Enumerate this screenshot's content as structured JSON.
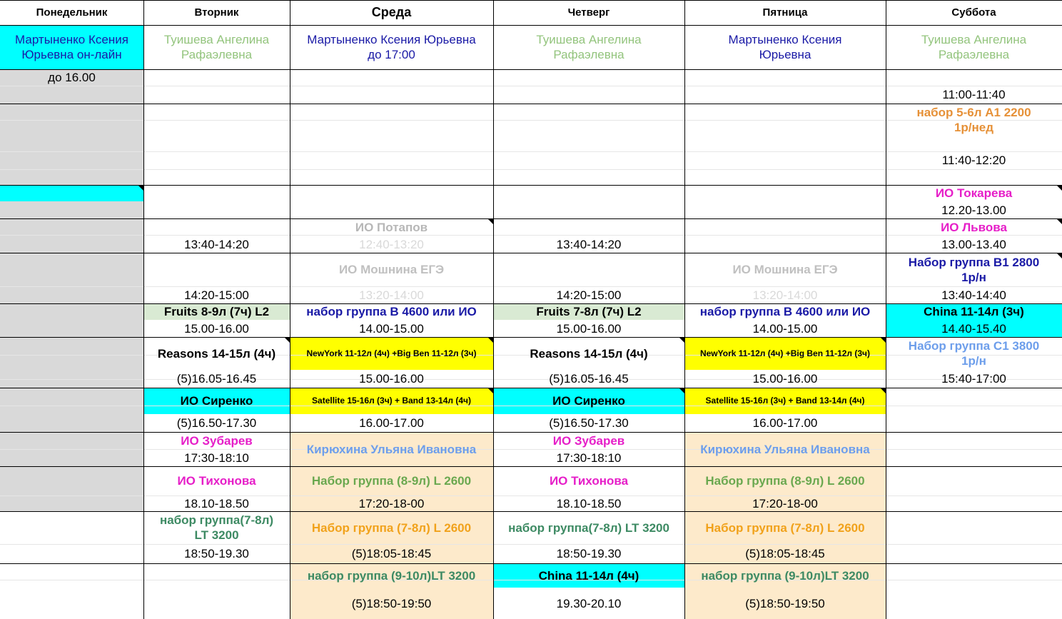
{
  "headers": [
    "Понедельник",
    "Вторник",
    "Среда",
    "Четверг",
    "Пятница",
    "Суббота"
  ],
  "cells": [
    {
      "name": "teacher-monday",
      "text": "Мартыненко Ксения\nЮрьевна он-лайн",
      "color": "#1a1aa6",
      "bold": false
    },
    {
      "name": "teacher-tuesday",
      "text": "Туишева Ангелина\nРафаэлевна",
      "color": "#93c47d",
      "bold": false
    },
    {
      "name": "teacher-wednesday",
      "text": "Мартыненко Ксения Юрьевна\nдо 17:00",
      "color": "#1a1aa6",
      "bold": false
    },
    {
      "name": "teacher-thursday",
      "text": "Туишева Ангелина\nРафаэлевна",
      "color": "#93c47d",
      "bold": false
    },
    {
      "name": "teacher-friday",
      "text": "Мартыненко Ксения\nЮрьевна",
      "color": "#1a1aa6",
      "bold": false
    },
    {
      "name": "teacher-saturday",
      "text": "Туишева Ангелина\nРафаэлевна",
      "color": "#93c47d",
      "bold": false
    },
    {
      "name": "monday-until",
      "text": "до 16.00",
      "color": "#000000",
      "bold": false
    },
    {
      "name": "sat-time-1100",
      "text": "11:00-11:40",
      "color": "#000000",
      "bold": false
    },
    {
      "name": "sat-nabor-a1",
      "text": "набор 5-6л A1 2200\n1р/нед",
      "color": "#e69138",
      "bold": true
    },
    {
      "name": "sat-time-1140",
      "text": "11:40-12:20",
      "color": "#000000",
      "bold": false
    },
    {
      "name": "sat-io-tokareva",
      "text": "ИО Токарева",
      "color": "#e61ec8",
      "bold": true
    },
    {
      "name": "sat-time-1220",
      "text": "12.20-13.00",
      "color": "#000000",
      "bold": false
    },
    {
      "name": "wed-io-potapov",
      "text": "ИО Потапов",
      "color": "#b7b7b7",
      "bold": true
    },
    {
      "name": "sat-io-lvova",
      "text": "ИО Львова",
      "color": "#e61ec8",
      "bold": true
    },
    {
      "name": "tue-time-1340",
      "text": "13:40-14:20",
      "color": "#000000",
      "bold": false
    },
    {
      "name": "wed-time-1240",
      "text": "12:40-13:20",
      "color": "#d9d9d9",
      "bold": false
    },
    {
      "name": "thu-time-1340",
      "text": "13:40-14:20",
      "color": "#000000",
      "bold": false
    },
    {
      "name": "sat-time-1300",
      "text": "13.00-13.40",
      "color": "#000000",
      "bold": false
    },
    {
      "name": "wed-io-moshnina",
      "text": "ИО Мошнина ЕГЭ",
      "color": "#c0c0c0",
      "bold": true
    },
    {
      "name": "fri-io-moshnina",
      "text": "ИО Мошнина ЕГЭ",
      "color": "#c0c0c0",
      "bold": true
    },
    {
      "name": "sat-nabor-b1",
      "text": "Набор группа B1 2800\n1р/н",
      "color": "#1a1aa6",
      "bold": true
    },
    {
      "name": "tue-time-1420",
      "text": "14:20-15:00",
      "color": "#000000",
      "bold": false
    },
    {
      "name": "wed-time-1320",
      "text": "13:20-14:00",
      "color": "#d9d9d9",
      "bold": false
    },
    {
      "name": "thu-time-1420",
      "text": "14:20-15:00",
      "color": "#000000",
      "bold": false
    },
    {
      "name": "fri-time-1320",
      "text": "13:20-14:00",
      "color": "#d9d9d9",
      "bold": false
    },
    {
      "name": "sat-time-1340",
      "text": "13:40-14:40",
      "color": "#000000",
      "bold": false
    },
    {
      "name": "tue-fruits",
      "text": "Fruits 8-9л (7ч) L2",
      "color": "#000000",
      "bold": true
    },
    {
      "name": "wed-nabor-b",
      "text": "набор группа B 4600 или ИО",
      "color": "#1a1aa6",
      "bold": true
    },
    {
      "name": "thu-fruits",
      "text": "Fruits 7-8л (7ч) L2",
      "color": "#000000",
      "bold": true
    },
    {
      "name": "fri-nabor-b",
      "text": "набор группа B 4600 или ИО",
      "color": "#1a1aa6",
      "bold": true
    },
    {
      "name": "sat-china",
      "text": "China 11-14л (3ч)",
      "color": "#000000",
      "bold": true
    },
    {
      "name": "tue-time-1500",
      "text": "15.00-16.00",
      "color": "#000000",
      "bold": false
    },
    {
      "name": "wed-time-1400",
      "text": "14.00-15.00",
      "color": "#000000",
      "bold": false
    },
    {
      "name": "thu-time-1500",
      "text": "15.00-16.00",
      "color": "#000000",
      "bold": false
    },
    {
      "name": "fri-time-1400",
      "text": "14.00-15.00",
      "color": "#000000",
      "bold": false
    },
    {
      "name": "sat-time-1440",
      "text": "14.40-15.40",
      "color": "#000000",
      "bold": false
    },
    {
      "name": "sat-nabor-c1",
      "text": "Набор группа C1 3800\n1р/н",
      "color": "#6d9eeb",
      "bold": true
    },
    {
      "name": "tue-reasons",
      "text": "Reasons 14-15л (4ч)",
      "color": "#000000",
      "bold": true
    },
    {
      "name": "wed-newyork",
      "text": "NewYork 11-12л (4ч) +Big Ben 11-12л (3ч)",
      "color": "#000000",
      "bold": true
    },
    {
      "name": "thu-reasons",
      "text": "Reasons 14-15л (4ч)",
      "color": "#000000",
      "bold": true
    },
    {
      "name": "fri-newyork",
      "text": "NewYork 11-12л (4ч) +Big Ben 11-12л (3ч)",
      "color": "#000000",
      "bold": true
    },
    {
      "name": "tue-time-1605",
      "text": "(5)16.05-16.45",
      "color": "#000000",
      "bold": false
    },
    {
      "name": "wed-time-1500",
      "text": "15.00-16.00",
      "color": "#000000",
      "bold": false
    },
    {
      "name": "thu-time-1605",
      "text": "(5)16.05-16.45",
      "color": "#000000",
      "bold": false
    },
    {
      "name": "fri-time-1500",
      "text": "15.00-16.00",
      "color": "#000000",
      "bold": false
    },
    {
      "name": "sat-time-1540",
      "text": "15:40-17:00",
      "color": "#000000",
      "bold": false
    },
    {
      "name": "tue-io-sirenko",
      "text": "ИО Сиренко",
      "color": "#000000",
      "bold": true
    },
    {
      "name": "wed-satellite",
      "text": "Satellite 15-16л (3ч) + Band 13-14л (4ч)",
      "color": "#000000",
      "bold": true
    },
    {
      "name": "thu-io-sirenko",
      "text": "ИО Сиренко",
      "color": "#000000",
      "bold": true
    },
    {
      "name": "fri-satellite",
      "text": "Satellite 15-16л (3ч) + Band 13-14л (4ч)",
      "color": "#000000",
      "bold": true
    },
    {
      "name": "tue-time-1650",
      "text": "(5)16.50-17.30",
      "color": "#000000",
      "bold": false
    },
    {
      "name": "wed-time-1600",
      "text": "16.00-17.00",
      "color": "#000000",
      "bold": false
    },
    {
      "name": "thu-time-1650",
      "text": "(5)16.50-17.30",
      "color": "#000000",
      "bold": false
    },
    {
      "name": "fri-time-1600",
      "text": "16.00-17.00",
      "color": "#000000",
      "bold": false
    },
    {
      "name": "tue-io-zubarev",
      "text": "ИО Зубарев",
      "color": "#e61ec8",
      "bold": true
    },
    {
      "name": "wed-kiryukhina",
      "text": "Кирюхина Ульяна Ивановна",
      "color": "#6d9eeb",
      "bold": true
    },
    {
      "name": "thu-io-zubarev",
      "text": "ИО Зубарев",
      "color": "#e61ec8",
      "bold": true
    },
    {
      "name": "fri-kiryukhina",
      "text": "Кирюхина Ульяна Ивановна",
      "color": "#6d9eeb",
      "bold": true
    },
    {
      "name": "tue-time-1730",
      "text": "17:30-18:10",
      "color": "#000000",
      "bold": false
    },
    {
      "name": "thu-time-1730",
      "text": "17:30-18:10",
      "color": "#000000",
      "bold": false
    },
    {
      "name": "tue-io-tikhonova",
      "text": "ИО Тихонова",
      "color": "#e61ec8",
      "bold": true
    },
    {
      "name": "wed-nabor-89",
      "text": "Набор группа (8-9л) L 2600",
      "color": "#6aa84f",
      "bold": true
    },
    {
      "name": "thu-io-tikhonova",
      "text": "ИО Тихонова",
      "color": "#e61ec8",
      "bold": true
    },
    {
      "name": "fri-nabor-89",
      "text": "Набор группа (8-9л) L 2600",
      "color": "#6aa84f",
      "bold": true
    },
    {
      "name": "tue-time-1810",
      "text": "18.10-18.50",
      "color": "#000000",
      "bold": false
    },
    {
      "name": "wed-time-1720",
      "text": "17:20-18-00",
      "color": "#000000",
      "bold": false
    },
    {
      "name": "thu-time-1810",
      "text": "18.10-18.50",
      "color": "#000000",
      "bold": false
    },
    {
      "name": "fri-time-1720",
      "text": "17:20-18-00",
      "color": "#000000",
      "bold": false
    },
    {
      "name": "tue-nabor-78",
      "text": "набор  группа(7-8л)\nLT 3200",
      "color": "#3d8a63",
      "bold": true
    },
    {
      "name": "wed-nabor-78",
      "text": "Набор группа (7-8л)  L 2600",
      "color": "#f1a21b",
      "bold": true
    },
    {
      "name": "thu-nabor-78",
      "text": "набор  группа(7-8л) LT 3200",
      "color": "#3d8a63",
      "bold": true
    },
    {
      "name": "fri-nabor-78",
      "text": "Набор группа (7-8л)  L 2600",
      "color": "#f1a21b",
      "bold": true
    },
    {
      "name": "tue-time-1850",
      "text": "18:50-19.30",
      "color": "#000000",
      "bold": false
    },
    {
      "name": "wed-time-1805",
      "text": "(5)18:05-18:45",
      "color": "#000000",
      "bold": false
    },
    {
      "name": "thu-time-1850",
      "text": "18:50-19.30",
      "color": "#000000",
      "bold": false
    },
    {
      "name": "fri-time-1805",
      "text": "(5)18:05-18:45",
      "color": "#000000",
      "bold": false
    },
    {
      "name": "wed-nabor-910",
      "text": "набор  группа (9-10л)LT 3200",
      "color": "#3d8a63",
      "bold": true
    },
    {
      "name": "thu-china",
      "text": "China 11-14л (4ч)",
      "color": "#000000",
      "bold": true
    },
    {
      "name": "fri-nabor-910",
      "text": "набор  группа (9-10л)LT 3200",
      "color": "#3d8a63",
      "bold": true
    },
    {
      "name": "wed-time-1850",
      "text": "(5)18:50-19:50",
      "color": "#000000",
      "bold": false
    },
    {
      "name": "thu-time-1930",
      "text": "19.30-20.10",
      "color": "#000000",
      "bold": false
    },
    {
      "name": "fri-time-1850",
      "text": "(5)18:50-19:50",
      "color": "#000000",
      "bold": false
    }
  ],
  "colors": {
    "gray_column": "#d9d9d9",
    "cyan": "#00ffff",
    "yellow": "#ffff00",
    "light_green": "#d9ead3",
    "beige": "#fdeacb"
  }
}
